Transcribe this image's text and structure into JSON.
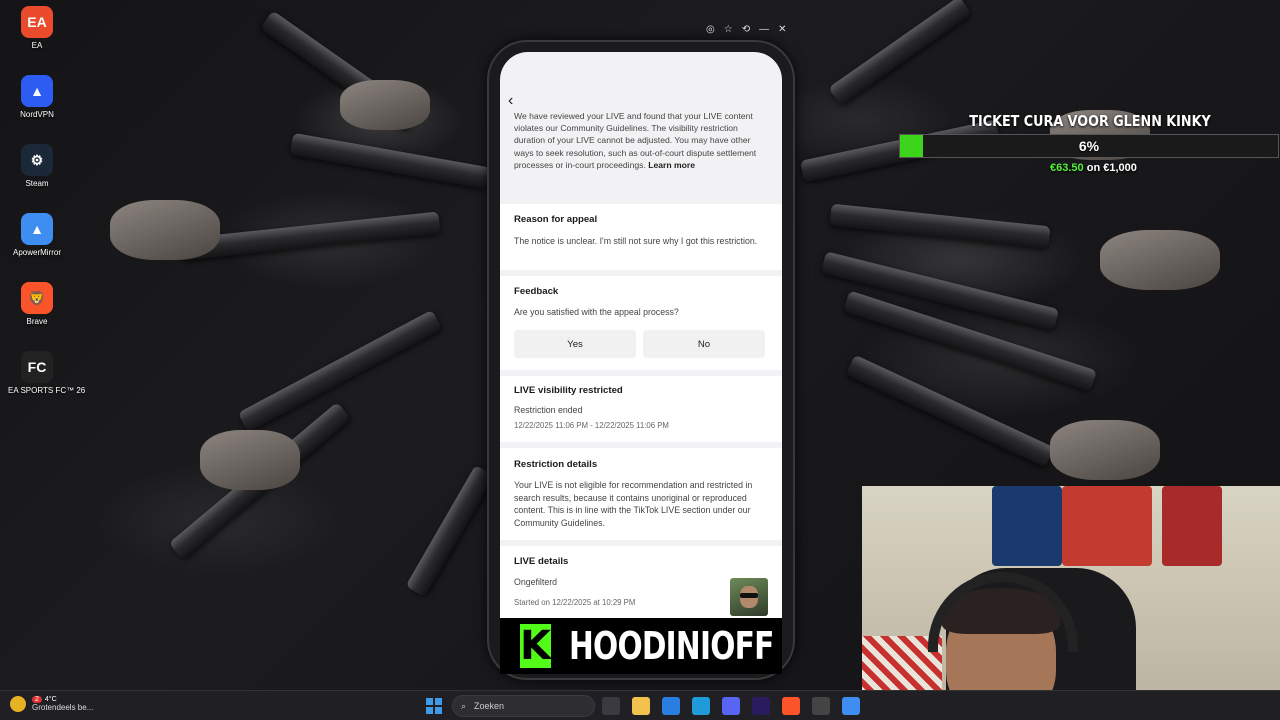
{
  "desktop_icons": [
    {
      "label": "EA",
      "icon": "ea-icon",
      "glyph": "EA",
      "color": "#e94b2c"
    },
    {
      "label": "NordVPN",
      "icon": "nordvpn-icon",
      "glyph": "▲",
      "color": "#2d5cf2"
    },
    {
      "label": "Steam",
      "icon": "steam-icon",
      "glyph": "⚙",
      "color": "#1b2838"
    },
    {
      "label": "ApowerMirror",
      "icon": "apowermirror-icon",
      "glyph": "▲",
      "color": "#3d8ef0"
    },
    {
      "label": "Brave",
      "icon": "brave-icon",
      "glyph": "🦁",
      "color": "#fb542b"
    },
    {
      "label": "EA SPORTS FC™ 26",
      "icon": "ea-sports-fc-icon",
      "glyph": "FC",
      "color": "#222222"
    }
  ],
  "mirror_window": {
    "controls": [
      "◎",
      "☆",
      "⟲",
      "—",
      "✕"
    ]
  },
  "phone": {
    "top_note": "We have reviewed your LIVE and found that your LIVE content violates our Community Guidelines. The visibility restriction duration of your LIVE cannot be adjusted. You may have other ways to seek resolution, such as out-of-court dispute settlement processes or in-court proceedings.",
    "learn_more": "Learn more",
    "reason": {
      "heading": "Reason for appeal",
      "text": "The notice is unclear. I'm still not sure why I got this restriction."
    },
    "feedback": {
      "heading": "Feedback",
      "question": "Are you satisfied with the appeal process?",
      "yes": "Yes",
      "no": "No"
    },
    "visibility": {
      "heading": "LIVE visibility restricted",
      "status": "Restriction ended",
      "range": "12/22/2025 11:06 PM - 12/22/2025 11:06 PM"
    },
    "details": {
      "heading": "Restriction details",
      "text": "Your LIVE is not eligible for recommendation and restricted in search results, because it contains unoriginal or reproduced content. This is in line with the TikTok LIVE section under our Community Guidelines."
    },
    "live_details": {
      "heading": "LIVE details",
      "title": "Ongefilterd",
      "started": "Started on 12/22/2025 at 10:29 PM"
    }
  },
  "banner": {
    "logo": "K",
    "name": "HOODINIOFF",
    "accent": "#53fc18"
  },
  "goal": {
    "title": "TICKET CURA VOOR GLENN KINKY",
    "percent_label": "6%",
    "progress_fraction": 0.06,
    "current": "€63.50",
    "sep": "on",
    "target": "€1,000",
    "bar_color": "#3dd41c"
  },
  "taskbar": {
    "weather_badge": "2",
    "temperature": "4°C",
    "weather_text": "Grotendeels be...",
    "search_placeholder": "Zoeken",
    "apps": [
      {
        "icon": "task-view-icon",
        "color": "#3a3a40"
      },
      {
        "icon": "file-explorer-icon",
        "color": "#f2c14e"
      },
      {
        "icon": "store-icon",
        "color": "#2a7de1"
      },
      {
        "icon": "edge-icon",
        "color": "#1f9bd9"
      },
      {
        "icon": "discord-icon",
        "color": "#5865f2"
      },
      {
        "icon": "premiere-icon",
        "color": "#2a1b5e"
      },
      {
        "icon": "brave-icon",
        "color": "#fb542b"
      },
      {
        "icon": "obs-icon",
        "color": "#444444"
      },
      {
        "icon": "apowermirror-icon",
        "color": "#3d8ef0"
      }
    ]
  }
}
